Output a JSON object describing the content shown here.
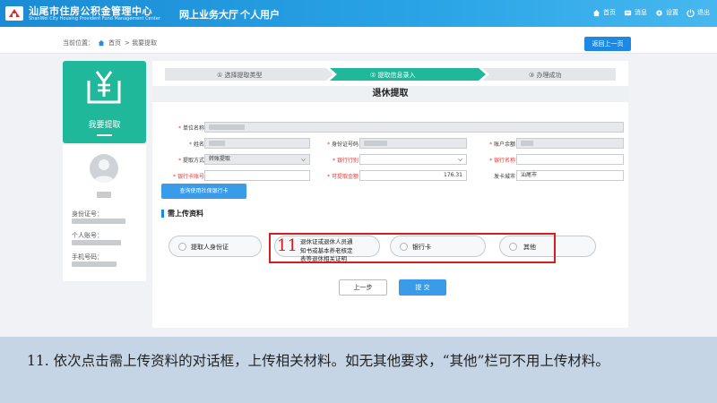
{
  "header": {
    "org_name": "汕尾市住房公积金管理中心",
    "org_name_en": "ShanWei City Housing Provident Fund Management Center",
    "hall_title": "网上业务大厅",
    "user_type": "个人用户",
    "nav": [
      {
        "label": "首页",
        "icon": "home-icon"
      },
      {
        "label": "消息",
        "icon": "message-icon"
      },
      {
        "label": "设置",
        "icon": "gear-icon"
      },
      {
        "label": "退出",
        "icon": "logout-icon"
      }
    ],
    "brand_color": "#1a8bd4"
  },
  "breadcrumb": {
    "prefix": "当前位置：",
    "home": "首页",
    "current": "> 我要提取"
  },
  "back_button": "返回上一页",
  "left_card": {
    "title": "我要提取",
    "accent": "#1fb89a"
  },
  "user_info": {
    "id_label": "身份证号：",
    "account_label": "个人账号：",
    "phone_label": "手机号码："
  },
  "steps": [
    {
      "label": "① 选择提取类型",
      "active": false
    },
    {
      "label": "② 提取信息录入",
      "active": true
    },
    {
      "label": "③ 办理成功",
      "active": false
    }
  ],
  "form": {
    "title": "退休提取",
    "unit_name_label": "单位名称",
    "name_label": "姓名",
    "id_number_label": "身份证号码",
    "balance_label": "账户余额",
    "method_label": "提取方式",
    "method_value": "转账提取",
    "bank_label": "银行行别",
    "bank_name_label": "银行名称",
    "card_label": "银行卡账号",
    "amount_label": "可提取金额",
    "amount_value": "176.31",
    "city_label": "发卡城市",
    "city_value": "汕尾市",
    "query_button": "查询使用社保银行卡"
  },
  "upload": {
    "section_title": "需上传资料",
    "items": [
      {
        "label": "提取人身份证"
      },
      {
        "label": "退休证或退休人员通知书或基本养老核定表等退休相关证明"
      },
      {
        "label": "银行卡"
      },
      {
        "label": "其他"
      }
    ]
  },
  "annotation_number": "11",
  "buttons": {
    "prev": "上一步",
    "submit": "提  交"
  },
  "caption": "11. 依次点击需上传资料的对话框，上传相关材料。如无其他要求，“其他”栏可不用上传材料。"
}
